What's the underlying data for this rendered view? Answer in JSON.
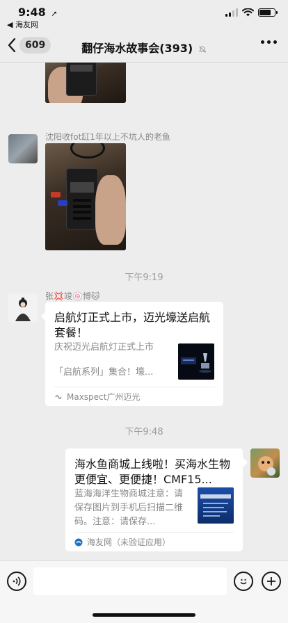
{
  "status_bar": {
    "time": "9:48",
    "location_arrow": "location-arrow-icon",
    "back_app": "◀ 海友网",
    "battery_level": 0.75
  },
  "nav": {
    "back_count": "609",
    "title": "翻仔海水故事会(393)"
  },
  "messages": {
    "sender1": "沈阳收fot缸1年以上不坑人的老鱼",
    "time1": "下午9:19",
    "sender2": "张💢竣🍥博🐱",
    "card1": {
      "title": "启航灯正式上市，迈光壕送启航套餐！",
      "desc_line1": "庆祝迈光启航灯正式上市",
      "desc_line2": "「启航系列」集合！壕...",
      "source": "Maxspect广州迈光"
    },
    "time2": "下午9:48",
    "card2": {
      "title": "海水鱼商城上线啦！买海水生物更便宜、更便捷！CMF15...",
      "desc": "蓝海海洋生物商城注意：请保存图片到手机后扫描二维码。注意：请保存...",
      "source": "海友网（未验证应用）"
    }
  },
  "colors": {
    "background": "#ededed",
    "card": "#ffffff",
    "muted_text": "#888888"
  }
}
